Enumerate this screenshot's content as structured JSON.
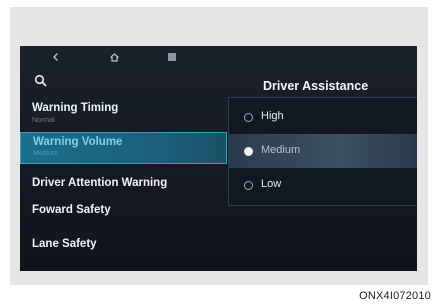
{
  "screen": {
    "top_buttons": [
      {
        "icon": "back-arrow-icon"
      },
      {
        "icon": "home-icon"
      },
      {
        "icon": "menu-icon"
      }
    ]
  },
  "sidebar": {
    "items": [
      {
        "label": "Warning Timing",
        "sub": "Normal"
      },
      {
        "label": "Warning Volume",
        "sub": "Medium",
        "active": true
      },
      {
        "label": "Driver Attention Warning",
        "sub": ""
      },
      {
        "label": "Foward Safety",
        "sub": ""
      },
      {
        "label": "Lane Safety",
        "sub": ""
      }
    ]
  },
  "panel": {
    "title": "Driver Assistance",
    "options": [
      {
        "label": "High"
      },
      {
        "label": "Medium",
        "selected": true
      },
      {
        "label": "Low"
      }
    ]
  },
  "caption": "ONX4I072010",
  "colors": {
    "accent": "#2aa3c8",
    "active_bg": "#1b6f8a",
    "screen_bg": "#141921"
  }
}
